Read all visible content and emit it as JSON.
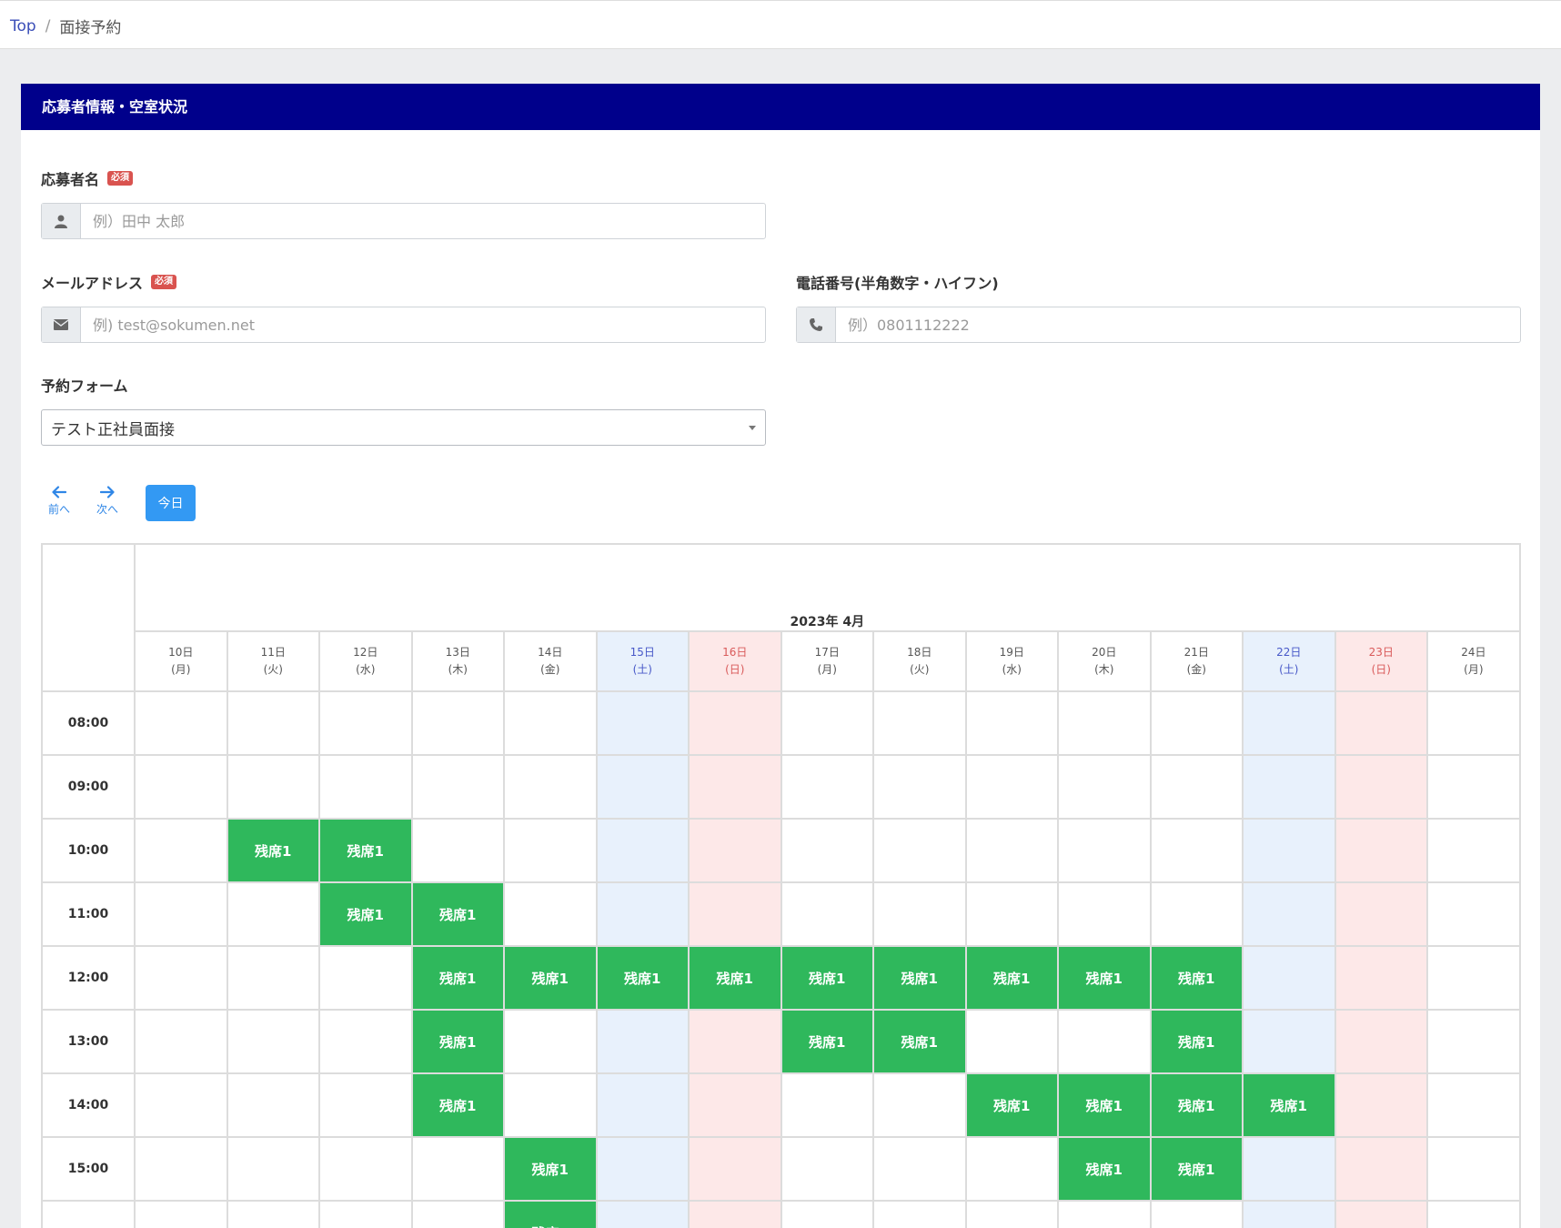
{
  "breadcrumb": {
    "home": "Top",
    "separator": "/",
    "current": "面接予約"
  },
  "panel": {
    "title": "応募者情報・空室状況"
  },
  "form": {
    "required_badge": "必須",
    "name": {
      "label": "応募者名",
      "placeholder": "例）田中 太郎",
      "icon": "user-icon"
    },
    "email": {
      "label": "メールアドレス",
      "placeholder": "例) test@sokumen.net",
      "icon": "envelope-icon"
    },
    "phone": {
      "label": "電話番号(半角数字・ハイフン)",
      "placeholder": "例）0801112222",
      "icon": "phone-icon"
    },
    "reservation": {
      "label": "予約フォーム",
      "selected": "テスト正社員面接"
    }
  },
  "calendar": {
    "prev_label": "前へ",
    "next_label": "次へ",
    "today_label": "今日",
    "month_label": "2023年 4月",
    "days": [
      {
        "date": "10日",
        "weekday": "(月)",
        "type": "weekday"
      },
      {
        "date": "11日",
        "weekday": "(火)",
        "type": "weekday"
      },
      {
        "date": "12日",
        "weekday": "(水)",
        "type": "weekday"
      },
      {
        "date": "13日",
        "weekday": "(木)",
        "type": "weekday"
      },
      {
        "date": "14日",
        "weekday": "(金)",
        "type": "weekday"
      },
      {
        "date": "15日",
        "weekday": "(土)",
        "type": "sat"
      },
      {
        "date": "16日",
        "weekday": "(日)",
        "type": "sun"
      },
      {
        "date": "17日",
        "weekday": "(月)",
        "type": "weekday"
      },
      {
        "date": "18日",
        "weekday": "(火)",
        "type": "weekday"
      },
      {
        "date": "19日",
        "weekday": "(水)",
        "type": "weekday"
      },
      {
        "date": "20日",
        "weekday": "(木)",
        "type": "weekday"
      },
      {
        "date": "21日",
        "weekday": "(金)",
        "type": "weekday"
      },
      {
        "date": "22日",
        "weekday": "(土)",
        "type": "sat"
      },
      {
        "date": "23日",
        "weekday": "(日)",
        "type": "sun"
      },
      {
        "date": "24日",
        "weekday": "(月)",
        "type": "weekday"
      }
    ],
    "slot_label": "残席1",
    "rows": [
      {
        "time": "08:00",
        "available": []
      },
      {
        "time": "09:00",
        "available": []
      },
      {
        "time": "10:00",
        "available": [
          1,
          2
        ]
      },
      {
        "time": "11:00",
        "available": [
          2,
          3
        ]
      },
      {
        "time": "12:00",
        "available": [
          3,
          4,
          5,
          6,
          7,
          8,
          9,
          10,
          11
        ]
      },
      {
        "time": "13:00",
        "available": [
          3,
          7,
          8,
          11
        ]
      },
      {
        "time": "14:00",
        "available": [
          3,
          9,
          10,
          11,
          12
        ]
      },
      {
        "time": "15:00",
        "available": [
          4,
          10,
          11
        ]
      },
      {
        "time": "",
        "available": [
          4
        ]
      }
    ]
  },
  "colors": {
    "header_bg": "#00008b",
    "available_bg": "#2fb85c",
    "saturday_bg": "#e8f1fc",
    "sunday_bg": "#fde8e8",
    "required_badge_bg": "#d9534f",
    "today_button_bg": "#3399f3"
  }
}
